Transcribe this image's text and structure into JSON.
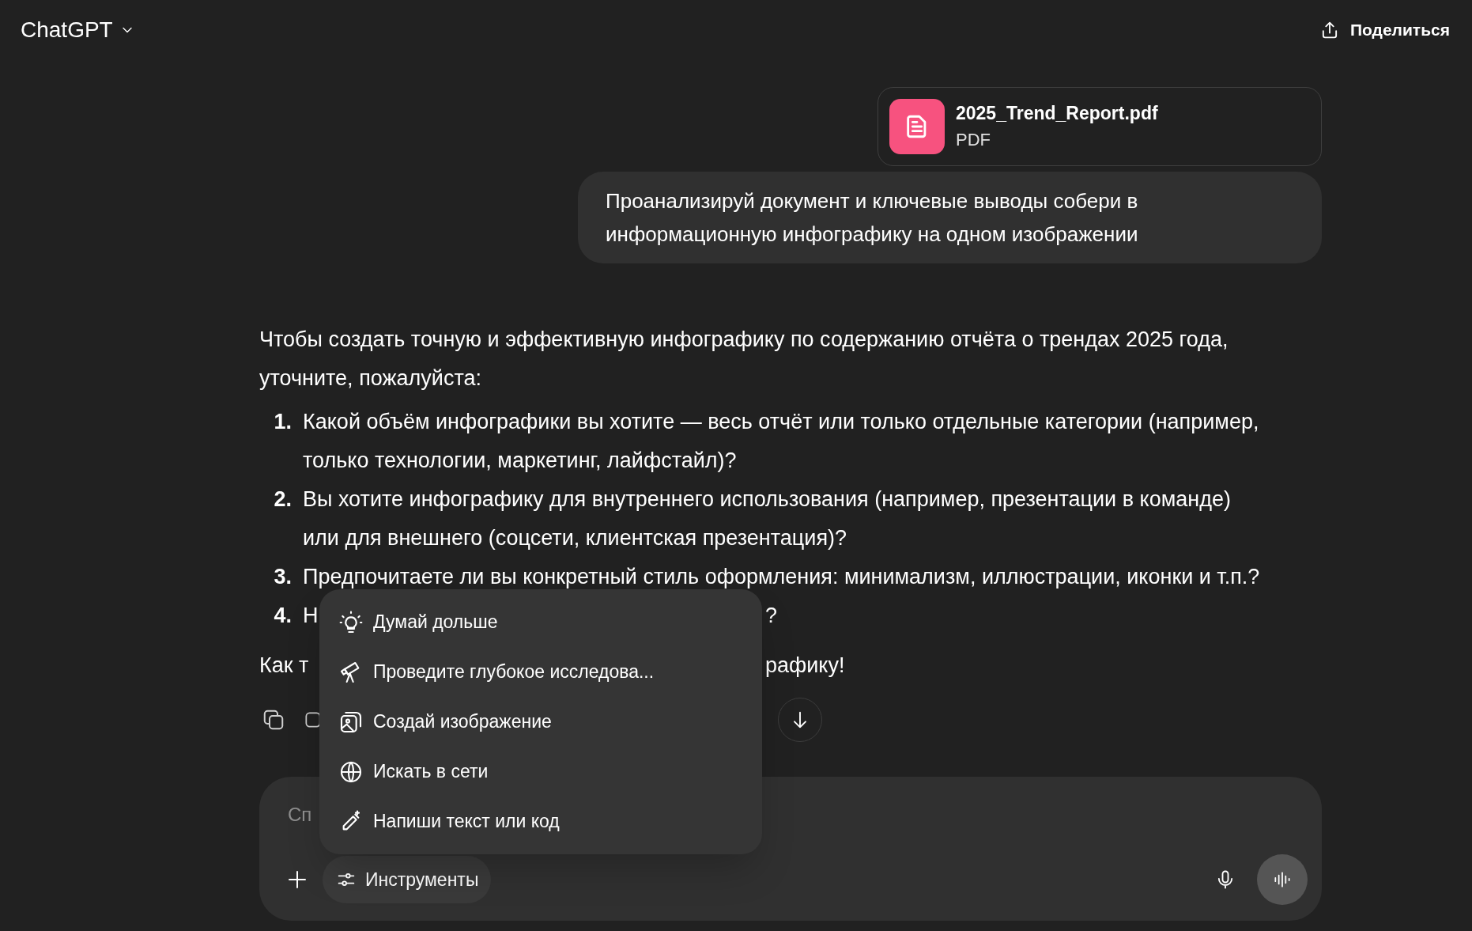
{
  "header": {
    "title": "ChatGPT",
    "share": "Поделиться"
  },
  "attachment": {
    "name": "2025_Trend_Report.pdf",
    "type": "PDF"
  },
  "user_message": "Проанализируй документ и ключевые выводы собери в информационную инфографику на одном изображении",
  "assistant": {
    "intro": "Чтобы создать точную и эффективную инфографику по содержанию отчёта о трендах 2025 года, уточните, пожалуйста:",
    "items": [
      {
        "number": "1.",
        "parts": [
          "Какой объём инфографики вы хотите — весь отчёт или только отдельные категории (например, только технологии, маркетинг, лайфстайл)?"
        ]
      },
      {
        "number": "2.",
        "parts": [
          "Вы хотите инфографику для внутреннего использования (например, презентации в команде) или для внешнего (соцсети, клиентская презентация)?"
        ]
      },
      {
        "number": "3.",
        "parts": [
          "Предпочитаете ли вы конкретный стиль оформления: минимализм, иллюстрации, иконки и т.п.?"
        ]
      },
      {
        "number": "4.",
        "parts": [
          "Н",
          "?"
        ]
      }
    ],
    "closing_parts": [
      "Как т",
      "рафику!"
    ]
  },
  "tools_menu": {
    "items": [
      {
        "kind": "think",
        "label": "Думай дольше"
      },
      {
        "kind": "research",
        "label": "Проведите глубокое исследова..."
      },
      {
        "kind": "image",
        "label": "Создай изображение"
      },
      {
        "kind": "web",
        "label": "Искать в сети"
      },
      {
        "kind": "write",
        "label": "Напиши текст или код"
      }
    ]
  },
  "composer": {
    "placeholder": "Сп",
    "tools_button": "Инструменты"
  }
}
